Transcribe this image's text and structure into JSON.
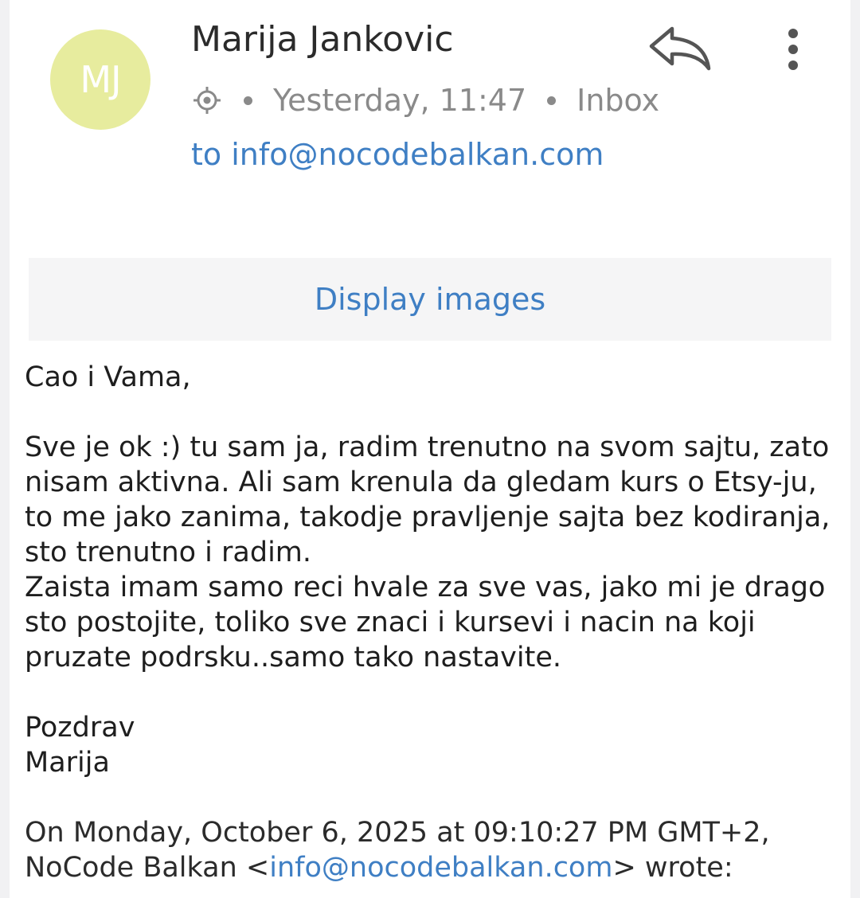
{
  "header": {
    "avatar_initials": "MJ",
    "avatar_color": "#e7ec9e",
    "sender_name": "Marija Jankovic",
    "location_icon": "location-target-icon",
    "timestamp": "Yesterday, 11:47",
    "folder": "Inbox",
    "to_line": "to info@nocodebalkan.com",
    "reply_icon": "reply-icon",
    "more_icon": "more-vertical-icon"
  },
  "banner": {
    "display_images_label": "Display images"
  },
  "message": {
    "greeting": "Cao i Vama,",
    "paragraph_1": "Sve je ok :) tu sam ja, radim trenutno na svom sajtu, zato nisam aktivna. Ali sam krenula da gledam kurs o Etsy-ju, to me jako zanima, takodje pravljenje sajta bez kodiranja, sto trenutno i radim.",
    "paragraph_2": "Zaista imam samo reci hvale za sve vas, jako mi je drago sto postojite, toliko sve znaci i kursevi i nacin na koji pruzate podrsku..samo tako nastavite.",
    "closing": "Pozdrav",
    "signature": "Marija"
  },
  "quote": {
    "line_1": "On Monday, October 6, 2025 at 09:10:27 PM GMT+2,",
    "sender_prefix": "NoCode Balkan <",
    "sender_email": "info@nocodebalkan.com",
    "sender_suffix": "> wrote:"
  },
  "colors": {
    "accent": "#3f7fc4",
    "text": "#1e1e1e",
    "muted": "#8a8a8a"
  }
}
